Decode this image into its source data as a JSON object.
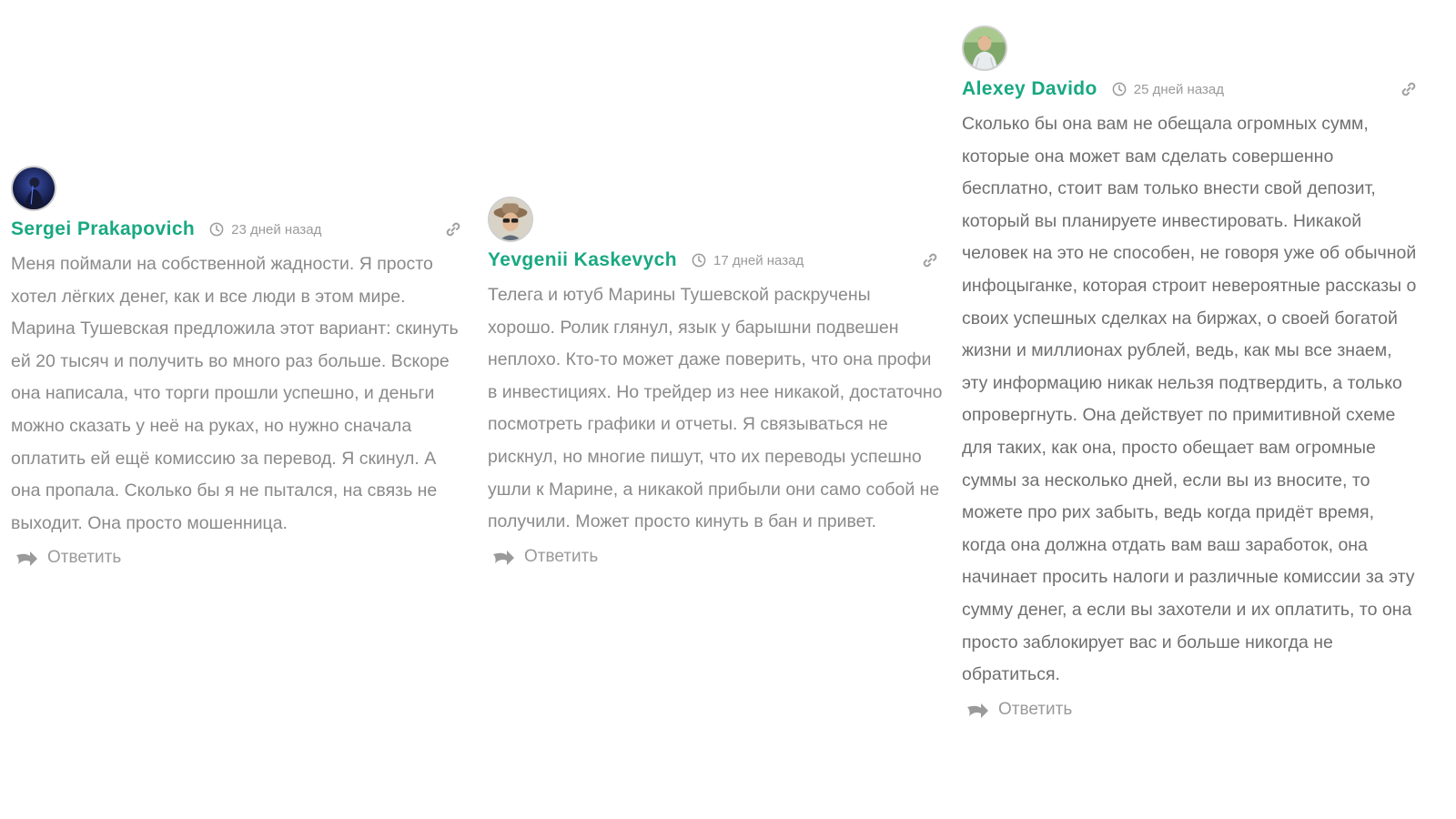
{
  "comments": [
    {
      "author": "Sergei Prakapovich",
      "time": "23 дней назад",
      "text": "Меня поймали на собственной жадности. Я просто хотел лёгких денег, как и все люди в этом мире. Марина Тушевская предложила этот вариант: скинуть ей 20 тысяч и получить во много раз больше. Вскоре она написала, что торги прошли успешно, и деньги можно сказать у неё на руках, но нужно сначала оплатить ей ещё комиссию за перевод. Я скинул. А она пропала. Сколько бы я не пытался, на связь не выходит. Она просто мошенница.",
      "reply_label": "Ответить"
    },
    {
      "author": "Yevgenii Kaskevych",
      "time": "17 дней назад",
      "text": "Телега и ютуб Марины Тушевской раскручены хорошо. Ролик глянул, язык у барышни подвешен неплохо. Кто-то может даже поверить, что она профи в инвестициях. Но трейдер из нее никакой, достаточно посмотреть графики и отчеты. Я связываться не рискнул, но многие пишут, что их переводы успешно ушли к Марине, а никакой прибыли они само собой не получили. Может просто кинуть в бан и привет.",
      "reply_label": "Ответить"
    },
    {
      "author": "Alexey Davido",
      "time": "25 дней назад",
      "text": "Сколько бы она вам не обещала огромных сумм, которые она может вам сделать совершенно бесплатно, стоит вам только внести свой депозит, который вы планируете инвестировать. Никакой человек на это не способен, не говоря уже об обычной инфоцыганке, которая строит невероятные рассказы о своих успешных сделках на биржах, о своей богатой жизни и миллионах рублей, ведь, как мы все знаем, эту информацию никак нельзя подтвердить, а только опровергнуть. Она действует по примитивной схеме для таких, как она, просто обещает вам огромные суммы за несколько дней, если вы из вносите, то можете про рих забыть, ведь когда придёт время, когда она должна отдать вам ваш заработок, она начинает просить налоги и различные комиссии за эту сумму денег, а если вы захотели и их оплатить, то она просто заблокирует вас и больше никогда не обратиться.",
      "reply_label": "Ответить"
    }
  ],
  "colors": {
    "author": "#19a882",
    "meta": "#9a9a9a",
    "text": "#8a8a8a"
  },
  "icons": {
    "time": "clock-icon",
    "permalink": "link-icon",
    "reply": "reply-arrow-icon"
  }
}
